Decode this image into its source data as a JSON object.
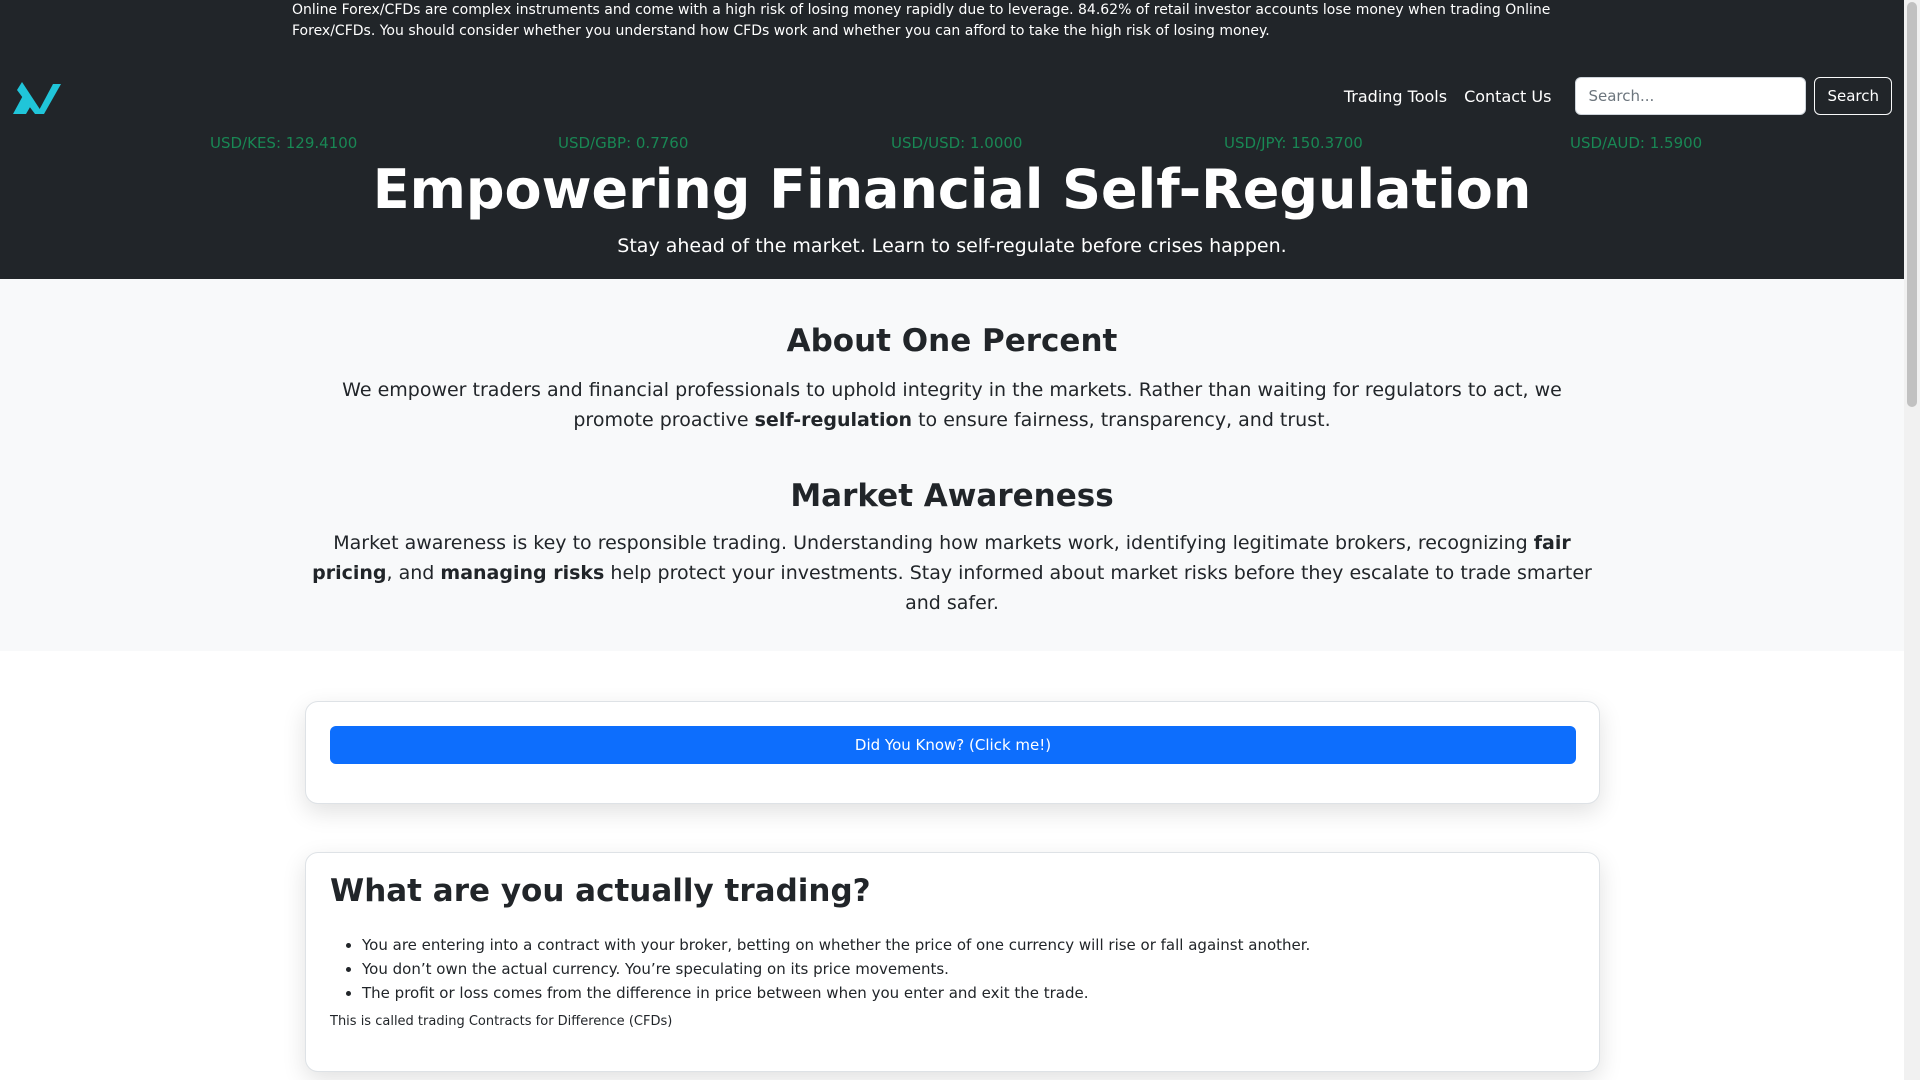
{
  "risk_warning": "Online Forex/CFDs are complex instruments and come with a high risk of losing money rapidly due to leverage. 84.62% of retail investor accounts lose money when trading Online Forex/CFDs. You should consider whether you understand how CFDs work and whether you can afford to take the high risk of losing money.",
  "logo": {
    "icon": "brand-logo-icon",
    "color": "#20c5d9"
  },
  "nav": {
    "links": [
      "Trading Tools",
      "Contact Us"
    ],
    "search_placeholder": "Search...",
    "search_button": "Search"
  },
  "ticker": [
    "USD/KES: 129.4100",
    "USD/GBP: 0.7760",
    "USD/USD: 1.0000",
    "USD/JPY: 150.3700",
    "USD/AUD: 1.5900"
  ],
  "hero": {
    "title": "Empowering Financial Self-Regulation",
    "subtitle": "Stay ahead of the market. Learn to self-regulate before crises happen."
  },
  "about": {
    "heading": "About One Percent",
    "text_before": "We empower traders and financial professionals to uphold integrity in the markets. Rather than waiting for regulators to act, we promote proactive ",
    "text_bold": "self-regulation",
    "text_after": " to ensure fairness, transparency, and trust."
  },
  "awareness": {
    "heading": "Market Awareness",
    "text_1": "Market awareness is key to responsible trading. Understanding how markets work, identifying legitimate brokers, recognizing ",
    "bold_1": "fair pricing",
    "text_2": ", and ",
    "bold_2": "managing risks",
    "text_3": " help protect your investments. Stay informed about market risks before they escalate to trade smarter and safer."
  },
  "did_you_know": {
    "button": "Did You Know? (Click me!)"
  },
  "trading_card": {
    "title": "What are you actually trading?",
    "items": [
      "You are entering into a contract with your broker, betting on whether the price of one currency will rise or fall against another.",
      "You don’t own the actual currency. You’re speculating on its price movements.",
      "The profit or loss comes from the difference in price between when you enter and exit the trade."
    ],
    "note": "This is called trading Contracts for Difference (CFDs)"
  },
  "colors": {
    "hero_bg": "#212529",
    "ticker": "#198754",
    "primary": "#0d6efd",
    "section_bg": "#f8f9fa"
  }
}
